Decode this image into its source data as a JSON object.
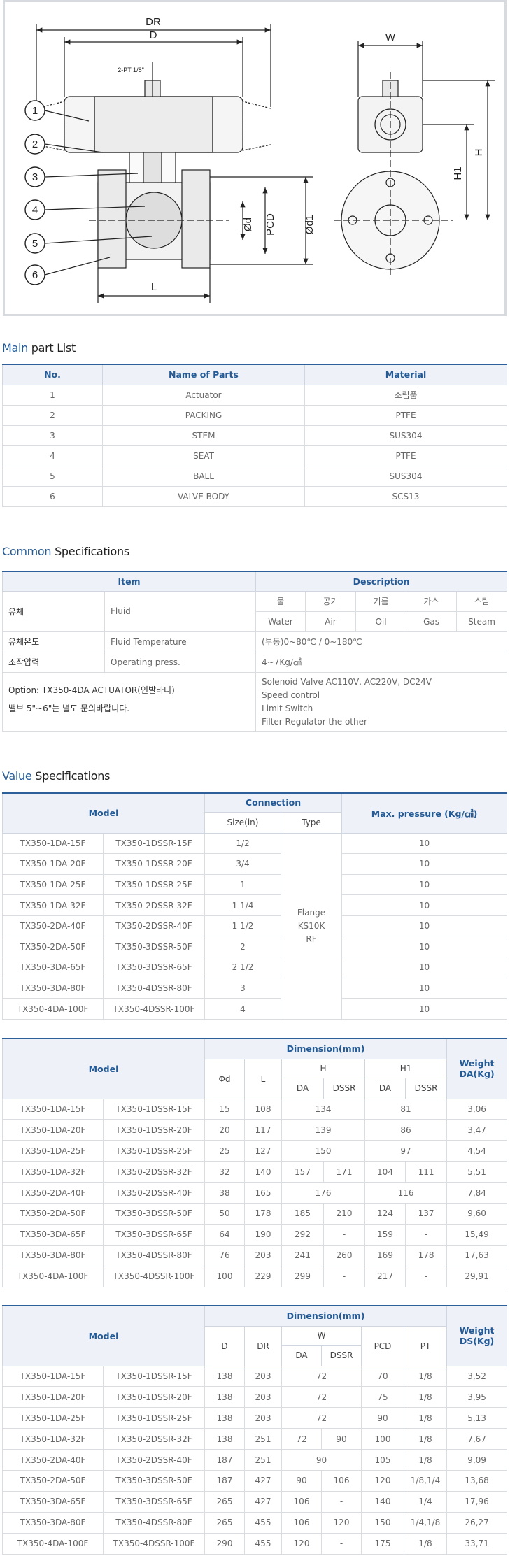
{
  "drawing": {
    "labels": {
      "dr": "DR",
      "d": "D",
      "w": "W",
      "pt": "2-PT 1/8\"",
      "h1": "H1",
      "h": "H",
      "pcd": "PCD",
      "phi_d": "Ød",
      "phi_d1": "Ød1",
      "l": "L"
    },
    "balloons": [
      "1",
      "2",
      "3",
      "4",
      "5",
      "6"
    ]
  },
  "parts": {
    "heading_highlight": "Main",
    "heading_rest": "part List",
    "columns": [
      "No.",
      "Name of Parts",
      "Material"
    ],
    "rows": [
      {
        "no": "1",
        "name": "Actuator",
        "material": "조립품"
      },
      {
        "no": "2",
        "name": "PACKING",
        "material": "PTFE"
      },
      {
        "no": "3",
        "name": "STEM",
        "material": "SUS304"
      },
      {
        "no": "4",
        "name": "SEAT",
        "material": "PTFE"
      },
      {
        "no": "5",
        "name": "BALL",
        "material": "SUS304"
      },
      {
        "no": "6",
        "name": "VALVE BODY",
        "material": "SCS13"
      }
    ]
  },
  "common": {
    "heading_highlight": "Common",
    "heading_rest": "Specifications",
    "col_item": "Item",
    "col_desc": "Description",
    "fluid_ko": "유체",
    "fluid_en": "Fluid",
    "fluid_types_ko": [
      "물",
      "공기",
      "기름",
      "가스",
      "스팀"
    ],
    "fluid_types_en": [
      "Water",
      "Air",
      "Oil",
      "Gas",
      "Steam"
    ],
    "temp_ko": "유체온도",
    "temp_en": "Fluid Temperature",
    "temp_val": "(부동)0~80℃ / 0~180℃",
    "press_ko": "조작압력",
    "press_en": "Operating press.",
    "press_val": "4~7Kg/㎠",
    "option_line1": "Option: TX350-4DA ACTUATOR(인발바디)",
    "option_line2": "밸브 5\"~6\"는 별도 문의바랍니다.",
    "option_desc": [
      "Solenoid Valve AC110V, AC220V, DC24V",
      "Speed control",
      "Limit Switch",
      "Filter Regulator the other"
    ]
  },
  "value": {
    "heading_highlight": "Value",
    "heading_rest": "Specifications",
    "col_model": "Model",
    "col_connection": "Connection",
    "col_size": "Size(in)",
    "col_type": "Type",
    "col_pressure": "Max. pressure (Kg/㎠)",
    "type_lines": [
      "Flange",
      "KS10K",
      "RF"
    ],
    "rows": [
      {
        "m1": "TX350-1DA-15F",
        "m2": "TX350-1DSSR-15F",
        "size": "1/2",
        "p": "10"
      },
      {
        "m1": "TX350-1DA-20F",
        "m2": "TX350-1DSSR-20F",
        "size": "3/4",
        "p": "10"
      },
      {
        "m1": "TX350-1DA-25F",
        "m2": "TX350-1DSSR-25F",
        "size": "1",
        "p": "10"
      },
      {
        "m1": "TX350-1DA-32F",
        "m2": "TX350-2DSSR-32F",
        "size": "1 1/4",
        "p": "10"
      },
      {
        "m1": "TX350-2DA-40F",
        "m2": "TX350-2DSSR-40F",
        "size": "1 1/2",
        "p": "10"
      },
      {
        "m1": "TX350-2DA-50F",
        "m2": "TX350-3DSSR-50F",
        "size": "2",
        "p": "10"
      },
      {
        "m1": "TX350-3DA-65F",
        "m2": "TX350-3DSSR-65F",
        "size": "2 1/2",
        "p": "10"
      },
      {
        "m1": "TX350-3DA-80F",
        "m2": "TX350-4DSSR-80F",
        "size": "3",
        "p": "10"
      },
      {
        "m1": "TX350-4DA-100F",
        "m2": "TX350-4DSSR-100F",
        "size": "4",
        "p": "10"
      }
    ]
  },
  "dim1": {
    "col_model": "Model",
    "col_dimension": "Dimension(mm)",
    "col_phid": "Φd",
    "col_l": "L",
    "col_h": "H",
    "col_h1": "H1",
    "col_da": "DA",
    "col_dssr": "DSSR",
    "col_weight_1": "Weight",
    "col_weight_2": "DA(Kg)",
    "rows": [
      {
        "m1": "TX350-1DA-15F",
        "m2": "TX350-1DSSR-15F",
        "d": "15",
        "l": "108",
        "h": "134",
        "h1": "81",
        "w": "3,06"
      },
      {
        "m1": "TX350-1DA-20F",
        "m2": "TX350-1DSSR-20F",
        "d": "20",
        "l": "117",
        "h": "139",
        "h1": "86",
        "w": "3,47"
      },
      {
        "m1": "TX350-1DA-25F",
        "m2": "TX350-1DSSR-25F",
        "d": "25",
        "l": "127",
        "h": "150",
        "h1": "97",
        "w": "4,54"
      },
      {
        "m1": "TX350-1DA-32F",
        "m2": "TX350-2DSSR-32F",
        "d": "32",
        "l": "140",
        "h_da": "157",
        "h_dssr": "171",
        "h1_da": "104",
        "h1_dssr": "111",
        "w": "5,51"
      },
      {
        "m1": "TX350-2DA-40F",
        "m2": "TX350-2DSSR-40F",
        "d": "38",
        "l": "165",
        "h": "176",
        "h1": "116",
        "w": "7,84"
      },
      {
        "m1": "TX350-2DA-50F",
        "m2": "TX350-3DSSR-50F",
        "d": "50",
        "l": "178",
        "h_da": "185",
        "h_dssr": "210",
        "h1_da": "124",
        "h1_dssr": "137",
        "w": "9,60"
      },
      {
        "m1": "TX350-3DA-65F",
        "m2": "TX350-3DSSR-65F",
        "d": "64",
        "l": "190",
        "h_da": "292",
        "h_dssr": "-",
        "h1_da": "159",
        "h1_dssr": "-",
        "w": "15,49"
      },
      {
        "m1": "TX350-3DA-80F",
        "m2": "TX350-4DSSR-80F",
        "d": "76",
        "l": "203",
        "h_da": "241",
        "h_dssr": "260",
        "h1_da": "169",
        "h1_dssr": "178",
        "w": "17,63"
      },
      {
        "m1": "TX350-4DA-100F",
        "m2": "TX350-4DSSR-100F",
        "d": "100",
        "l": "229",
        "h_da": "299",
        "h_dssr": "-",
        "h1_da": "217",
        "h1_dssr": "-",
        "w": "29,91"
      }
    ]
  },
  "dim2": {
    "col_model": "Model",
    "col_dimension": "Dimension(mm)",
    "col_d": "D",
    "col_dr": "DR",
    "col_w": "W",
    "col_da": "DA",
    "col_dssr": "DSSR",
    "col_pcd": "PCD",
    "col_pt": "PT",
    "col_weight_1": "Weight",
    "col_weight_2": "DS(Kg)",
    "rows": [
      {
        "m1": "TX350-1DA-15F",
        "m2": "TX350-1DSSR-15F",
        "d": "138",
        "dr": "203",
        "w": "72",
        "pcd": "70",
        "pt": "1/8",
        "wt": "3,52"
      },
      {
        "m1": "TX350-1DA-20F",
        "m2": "TX350-1DSSR-20F",
        "d": "138",
        "dr": "203",
        "w": "72",
        "pcd": "75",
        "pt": "1/8",
        "wt": "3,95"
      },
      {
        "m1": "TX350-1DA-25F",
        "m2": "TX350-1DSSR-25F",
        "d": "138",
        "dr": "203",
        "w": "72",
        "pcd": "90",
        "pt": "1/8",
        "wt": "5,13"
      },
      {
        "m1": "TX350-1DA-32F",
        "m2": "TX350-2DSSR-32F",
        "d": "138",
        "dr": "251",
        "w_da": "72",
        "w_dssr": "90",
        "pcd": "100",
        "pt": "1/8",
        "wt": "7,67"
      },
      {
        "m1": "TX350-2DA-40F",
        "m2": "TX350-2DSSR-40F",
        "d": "187",
        "dr": "251",
        "w": "90",
        "pcd": "105",
        "pt": "1/8",
        "wt": "9,09"
      },
      {
        "m1": "TX350-2DA-50F",
        "m2": "TX350-3DSSR-50F",
        "d": "187",
        "dr": "427",
        "w_da": "90",
        "w_dssr": "106",
        "pcd": "120",
        "pt": "1/8,1/4",
        "wt": "13,68"
      },
      {
        "m1": "TX350-3DA-65F",
        "m2": "TX350-3DSSR-65F",
        "d": "265",
        "dr": "427",
        "w_da": "106",
        "w_dssr": "-",
        "pcd": "140",
        "pt": "1/4",
        "wt": "17,96"
      },
      {
        "m1": "TX350-3DA-80F",
        "m2": "TX350-4DSSR-80F",
        "d": "265",
        "dr": "455",
        "w_da": "106",
        "w_dssr": "120",
        "pcd": "150",
        "pt": "1/4,1/8",
        "wt": "26,27"
      },
      {
        "m1": "TX350-4DA-100F",
        "m2": "TX350-4DSSR-100F",
        "d": "290",
        "dr": "455",
        "w_da": "120",
        "w_dssr": "-",
        "pcd": "175",
        "pt": "1/8",
        "wt": "33,71"
      }
    ]
  }
}
